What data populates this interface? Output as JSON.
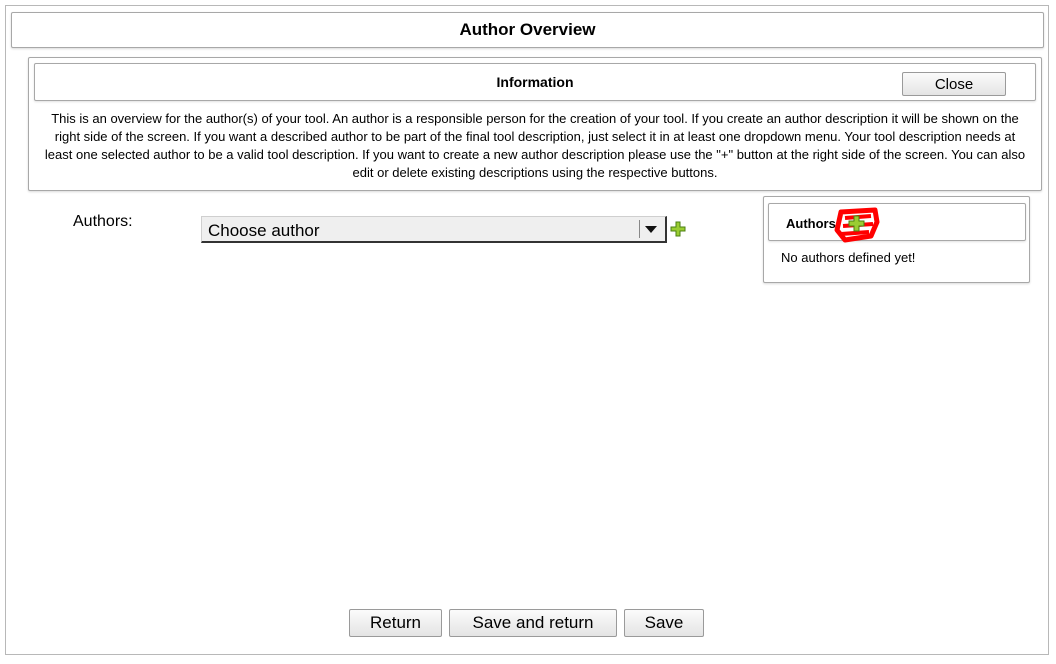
{
  "dialog": {
    "title": "Author Overview"
  },
  "info": {
    "title": "Information",
    "close_label": "Close",
    "text": "This is an overview for the author(s) of your tool. An author is a responsible person for the creation of your tool. If you create an author description it will be shown on the right side of the screen. If you want a described author to be part of the final tool description, just select it in at least one dropdown menu. Your tool description needs at least one selected author to be a valid tool description. If you want to create a new author description please use the \"+\" button at the right side of the screen. You can also edit or delete existing descriptions using the respective buttons."
  },
  "form": {
    "authors_label": "Authors:",
    "author_select_value": "Choose author",
    "add_icon": "plus-icon"
  },
  "side_panel": {
    "title": "Authors",
    "add_icon": "plus-icon",
    "empty_text": "No authors defined yet!",
    "highlight_color": "#ff0000"
  },
  "footer": {
    "return_label": "Return",
    "save_and_return_label": "Save and return",
    "save_label": "Save"
  },
  "colors": {
    "plus_fill": "#9acd32",
    "plus_stroke": "#4a7f10"
  }
}
